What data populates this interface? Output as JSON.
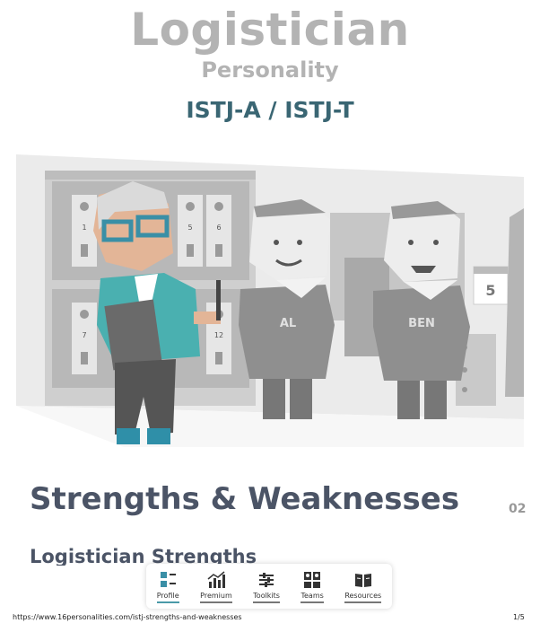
{
  "header": {
    "title": "Logistician",
    "subtitle": "Personality",
    "types": "ISTJ-A / ISTJ-T"
  },
  "illustration": {
    "locker_numbers": [
      "1",
      "5",
      "6",
      "7",
      "12"
    ],
    "characters": [
      "AL",
      "BEN"
    ],
    "calendar_number": "5"
  },
  "section": {
    "title": "Strengths & Weaknesses",
    "number": "02",
    "subtitle": "Logistician Strengths"
  },
  "nav": {
    "items": [
      {
        "label": "Profile",
        "icon": "profile-icon",
        "active": true
      },
      {
        "label": "Premium",
        "icon": "chart-icon",
        "active": false
      },
      {
        "label": "Toolkits",
        "icon": "sliders-icon",
        "active": false
      },
      {
        "label": "Teams",
        "icon": "teams-icon",
        "active": false
      },
      {
        "label": "Resources",
        "icon": "book-icon",
        "active": false
      }
    ]
  },
  "footer": {
    "url": "https://www.16personalities.com/istj-strengths-and-weaknesses",
    "page": "1/5"
  },
  "colors": {
    "title_gray": "#b3b3b3",
    "type_teal": "#3a6673",
    "heading": "#4b5466",
    "accent_teal": "#4a9aa8"
  }
}
